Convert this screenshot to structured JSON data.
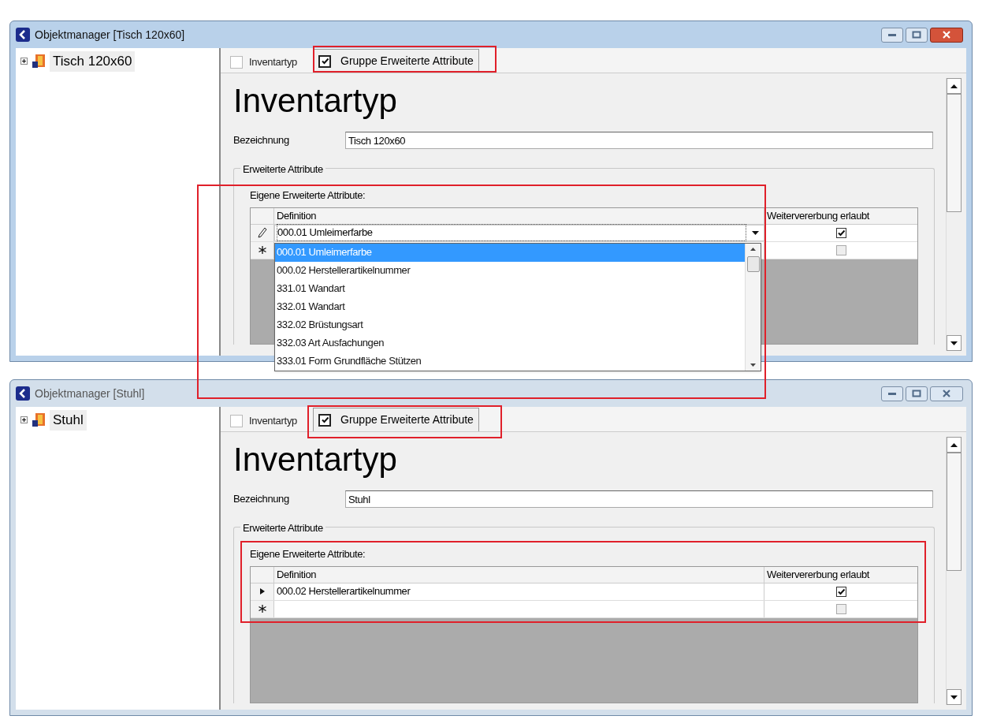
{
  "windows": [
    {
      "title": "Objektmanager [Tisch 120x60]",
      "active": true,
      "tree": [
        {
          "label": "Tisch 120x60",
          "expanded": false,
          "selected": true
        }
      ],
      "tabs": [
        {
          "label": "Inventartyp",
          "checked": false,
          "selected": false
        },
        {
          "label": "Gruppe Erweiterte Attribute",
          "checked": true,
          "selected": true
        }
      ],
      "heading": "Inventartyp",
      "field": {
        "label": "Bezeichnung",
        "value": "Tisch 120x60"
      },
      "group_title": "Erweiterte Attribute",
      "grid": {
        "caption": "Eigene Erweiterte Attribute:",
        "columns": [
          "Definition",
          "Weitervererbung erlaubt"
        ],
        "rows": [
          {
            "kind": "editing",
            "definition": "000.01 Umleimerfarbe",
            "inherit_allowed": true
          },
          {
            "kind": "new",
            "definition": "",
            "inherit_allowed": false
          }
        ],
        "dropdown": {
          "items": [
            {
              "label": "000.01 Umleimerfarbe",
              "selected": true
            },
            {
              "label": "000.02 Herstellerartikelnummer",
              "selected": false
            },
            {
              "label": "331.01 Wandart",
              "selected": false
            },
            {
              "label": "332.01 Wandart",
              "selected": false
            },
            {
              "label": "332.02 Brüstungsart",
              "selected": false
            },
            {
              "label": "332.03 Art Ausfachungen",
              "selected": false
            },
            {
              "label": "333.01 Form Grundfläche Stützen",
              "selected": false
            }
          ]
        }
      }
    },
    {
      "title": "Objektmanager [Stuhl]",
      "active": false,
      "tree": [
        {
          "label": "Stuhl",
          "expanded": false,
          "selected": true
        }
      ],
      "tabs": [
        {
          "label": "Inventartyp",
          "checked": false,
          "selected": false
        },
        {
          "label": "Gruppe Erweiterte Attribute",
          "checked": true,
          "selected": true
        }
      ],
      "heading": "Inventartyp",
      "field": {
        "label": "Bezeichnung",
        "value": "Stuhl"
      },
      "group_title": "Erweiterte Attribute",
      "grid": {
        "caption": "Eigene Erweiterte Attribute:",
        "columns": [
          "Definition",
          "Weitervererbung erlaubt"
        ],
        "rows": [
          {
            "kind": "current",
            "definition": "000.02 Herstellerartikelnummer",
            "inherit_allowed": true
          },
          {
            "kind": "new",
            "definition": "",
            "inherit_allowed": false
          }
        ]
      }
    }
  ]
}
